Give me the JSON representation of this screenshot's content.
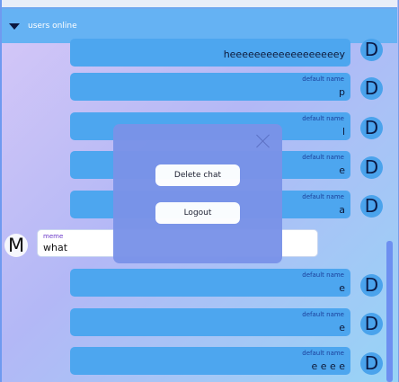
{
  "header": {
    "label": "users online",
    "toggle_icon": "triangle-down-icon"
  },
  "messages": [
    {
      "sender": "",
      "text": "heeeeeeeeeeeeeeeeeey",
      "avatar": "D"
    },
    {
      "sender": "default name",
      "text": "p",
      "avatar": "D"
    },
    {
      "sender": "default name",
      "text": "l",
      "avatar": "D"
    },
    {
      "sender": "default name",
      "text": "e",
      "avatar": "D"
    },
    {
      "sender": "default name",
      "text": "a",
      "avatar": "D"
    },
    {
      "sender": "default name",
      "text": "e",
      "avatar": "D"
    },
    {
      "sender": "default name",
      "text": "e",
      "avatar": "D"
    },
    {
      "sender": "default name",
      "text": "e e e e",
      "avatar": "D"
    }
  ],
  "own_message": {
    "sender": "meme",
    "text": "what",
    "avatar": "M"
  },
  "modal": {
    "delete_label": "Delete chat",
    "logout_label": "Logout",
    "close_icon": "close-icon"
  },
  "colors": {
    "header": "#65b2f3",
    "bubble": "#4da6ef",
    "modal": "#7a93e8",
    "accent": "#6a38c8"
  }
}
